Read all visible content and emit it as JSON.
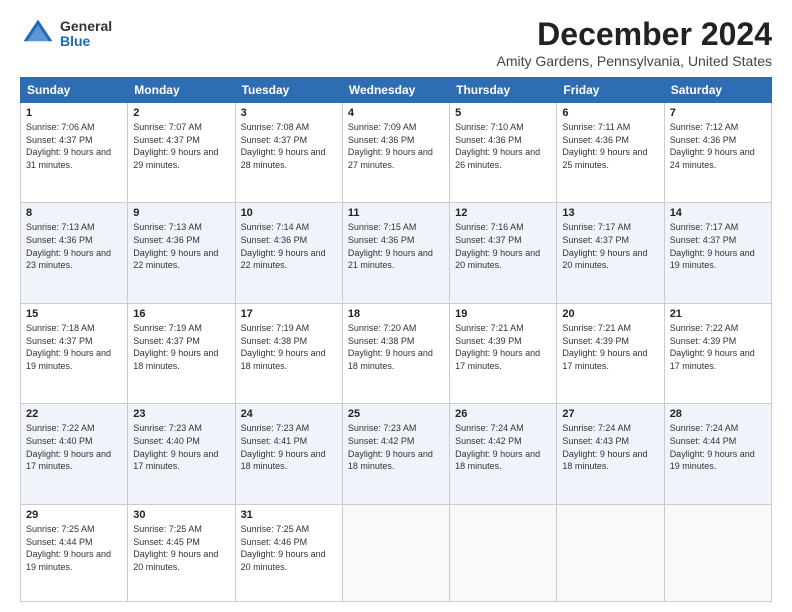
{
  "logo": {
    "general": "General",
    "blue": "Blue"
  },
  "header": {
    "month": "December 2024",
    "location": "Amity Gardens, Pennsylvania, United States"
  },
  "weekdays": [
    "Sunday",
    "Monday",
    "Tuesday",
    "Wednesday",
    "Thursday",
    "Friday",
    "Saturday"
  ],
  "weeks": [
    [
      {
        "day": "1",
        "sunrise": "7:06 AM",
        "sunset": "4:37 PM",
        "daylight": "9 hours and 31 minutes."
      },
      {
        "day": "2",
        "sunrise": "7:07 AM",
        "sunset": "4:37 PM",
        "daylight": "9 hours and 29 minutes."
      },
      {
        "day": "3",
        "sunrise": "7:08 AM",
        "sunset": "4:37 PM",
        "daylight": "9 hours and 28 minutes."
      },
      {
        "day": "4",
        "sunrise": "7:09 AM",
        "sunset": "4:36 PM",
        "daylight": "9 hours and 27 minutes."
      },
      {
        "day": "5",
        "sunrise": "7:10 AM",
        "sunset": "4:36 PM",
        "daylight": "9 hours and 26 minutes."
      },
      {
        "day": "6",
        "sunrise": "7:11 AM",
        "sunset": "4:36 PM",
        "daylight": "9 hours and 25 minutes."
      },
      {
        "day": "7",
        "sunrise": "7:12 AM",
        "sunset": "4:36 PM",
        "daylight": "9 hours and 24 minutes."
      }
    ],
    [
      {
        "day": "8",
        "sunrise": "7:13 AM",
        "sunset": "4:36 PM",
        "daylight": "9 hours and 23 minutes."
      },
      {
        "day": "9",
        "sunrise": "7:13 AM",
        "sunset": "4:36 PM",
        "daylight": "9 hours and 22 minutes."
      },
      {
        "day": "10",
        "sunrise": "7:14 AM",
        "sunset": "4:36 PM",
        "daylight": "9 hours and 22 minutes."
      },
      {
        "day": "11",
        "sunrise": "7:15 AM",
        "sunset": "4:36 PM",
        "daylight": "9 hours and 21 minutes."
      },
      {
        "day": "12",
        "sunrise": "7:16 AM",
        "sunset": "4:37 PM",
        "daylight": "9 hours and 20 minutes."
      },
      {
        "day": "13",
        "sunrise": "7:17 AM",
        "sunset": "4:37 PM",
        "daylight": "9 hours and 20 minutes."
      },
      {
        "day": "14",
        "sunrise": "7:17 AM",
        "sunset": "4:37 PM",
        "daylight": "9 hours and 19 minutes."
      }
    ],
    [
      {
        "day": "15",
        "sunrise": "7:18 AM",
        "sunset": "4:37 PM",
        "daylight": "9 hours and 19 minutes."
      },
      {
        "day": "16",
        "sunrise": "7:19 AM",
        "sunset": "4:37 PM",
        "daylight": "9 hours and 18 minutes."
      },
      {
        "day": "17",
        "sunrise": "7:19 AM",
        "sunset": "4:38 PM",
        "daylight": "9 hours and 18 minutes."
      },
      {
        "day": "18",
        "sunrise": "7:20 AM",
        "sunset": "4:38 PM",
        "daylight": "9 hours and 18 minutes."
      },
      {
        "day": "19",
        "sunrise": "7:21 AM",
        "sunset": "4:39 PM",
        "daylight": "9 hours and 17 minutes."
      },
      {
        "day": "20",
        "sunrise": "7:21 AM",
        "sunset": "4:39 PM",
        "daylight": "9 hours and 17 minutes."
      },
      {
        "day": "21",
        "sunrise": "7:22 AM",
        "sunset": "4:39 PM",
        "daylight": "9 hours and 17 minutes."
      }
    ],
    [
      {
        "day": "22",
        "sunrise": "7:22 AM",
        "sunset": "4:40 PM",
        "daylight": "9 hours and 17 minutes."
      },
      {
        "day": "23",
        "sunrise": "7:23 AM",
        "sunset": "4:40 PM",
        "daylight": "9 hours and 17 minutes."
      },
      {
        "day": "24",
        "sunrise": "7:23 AM",
        "sunset": "4:41 PM",
        "daylight": "9 hours and 18 minutes."
      },
      {
        "day": "25",
        "sunrise": "7:23 AM",
        "sunset": "4:42 PM",
        "daylight": "9 hours and 18 minutes."
      },
      {
        "day": "26",
        "sunrise": "7:24 AM",
        "sunset": "4:42 PM",
        "daylight": "9 hours and 18 minutes."
      },
      {
        "day": "27",
        "sunrise": "7:24 AM",
        "sunset": "4:43 PM",
        "daylight": "9 hours and 18 minutes."
      },
      {
        "day": "28",
        "sunrise": "7:24 AM",
        "sunset": "4:44 PM",
        "daylight": "9 hours and 19 minutes."
      }
    ],
    [
      {
        "day": "29",
        "sunrise": "7:25 AM",
        "sunset": "4:44 PM",
        "daylight": "9 hours and 19 minutes."
      },
      {
        "day": "30",
        "sunrise": "7:25 AM",
        "sunset": "4:45 PM",
        "daylight": "9 hours and 20 minutes."
      },
      {
        "day": "31",
        "sunrise": "7:25 AM",
        "sunset": "4:46 PM",
        "daylight": "9 hours and 20 minutes."
      },
      null,
      null,
      null,
      null
    ]
  ]
}
